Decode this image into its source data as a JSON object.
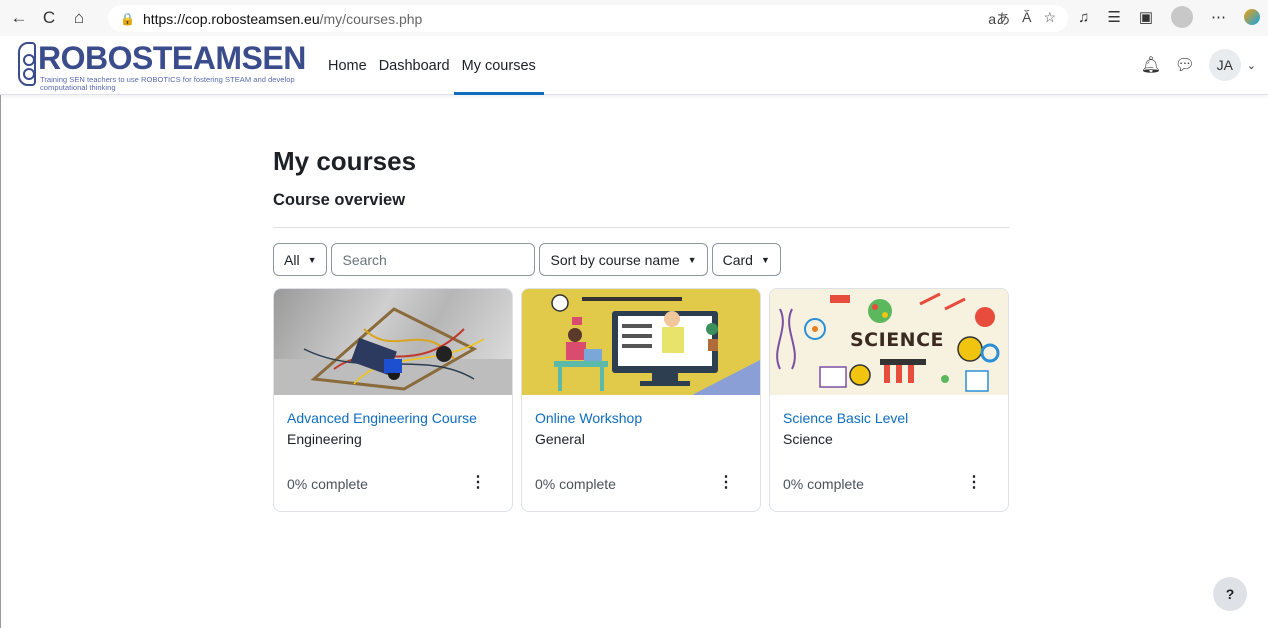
{
  "browser": {
    "url_host": "https://cop.robosteamsen.eu",
    "url_path": "/my/courses.php",
    "back_icon": "←",
    "refresh_icon": "C",
    "home_icon": "⌂"
  },
  "site": {
    "logo_title": "ROBOSTEAMSEN",
    "logo_tagline": "Training SEN teachers to use ROBOTICS for fostering STEAM and develop computational thinking",
    "nav": [
      "Home",
      "Dashboard",
      "My courses"
    ],
    "user_initials": "JA"
  },
  "page": {
    "title": "My courses",
    "section": "Course overview"
  },
  "controls": {
    "filter": "All",
    "search_placeholder": "Search",
    "sort": "Sort by course name",
    "view": "Card"
  },
  "courses": [
    {
      "name": "Advanced Engineering Course",
      "category": "Engineering",
      "progress": "0% complete"
    },
    {
      "name": "Online Workshop",
      "category": "General",
      "progress": "0% complete"
    },
    {
      "name": "Science Basic Level",
      "category": "Science",
      "progress": "0% complete"
    }
  ],
  "science_image_text": "SCIENCE",
  "help": "?"
}
